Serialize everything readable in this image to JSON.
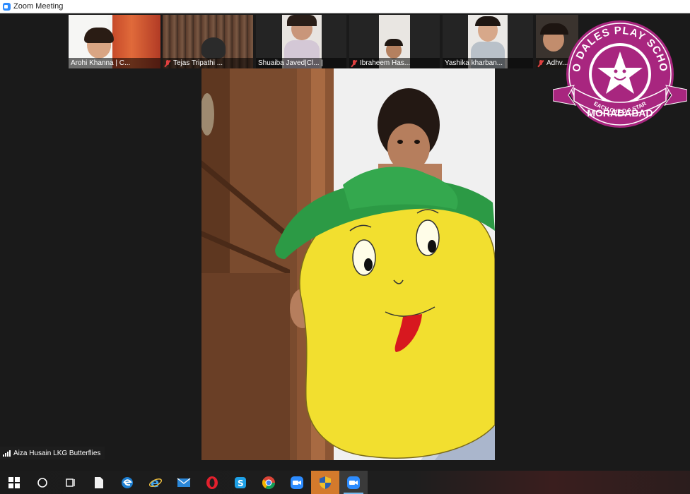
{
  "window": {
    "title": "Zoom Meeting"
  },
  "participants": [
    {
      "name": "Arohi Khanna | C...",
      "muted": false
    },
    {
      "name": "Tejas Tripathi ...",
      "muted": true
    },
    {
      "name": "Shuaiba Javed|Cl... |",
      "muted": false
    },
    {
      "name": "Ibraheem Has...",
      "muted": true
    },
    {
      "name": "Yashika kharban...",
      "muted": false
    },
    {
      "name": "Adhv...",
      "muted": true
    }
  ],
  "active_speaker": {
    "name": "Aiza Husain LKG Butterflies"
  },
  "logo": {
    "top_text": "NEO DALES PLAY SCHOOL",
    "banner_text": "EACH CHILD A STAR",
    "bottom_text": "MORADABAD",
    "color": "#a8267f"
  },
  "taskbar": {
    "items": [
      "windows-start-icon",
      "search-circle-icon",
      "task-view-icon",
      "file-icon",
      "edge-icon",
      "ie-icon",
      "mail-icon",
      "opera-icon",
      "skype-icon",
      "chrome-icon",
      "zoom-icon",
      "security-shield-icon",
      "zoom-meeting-icon"
    ]
  }
}
